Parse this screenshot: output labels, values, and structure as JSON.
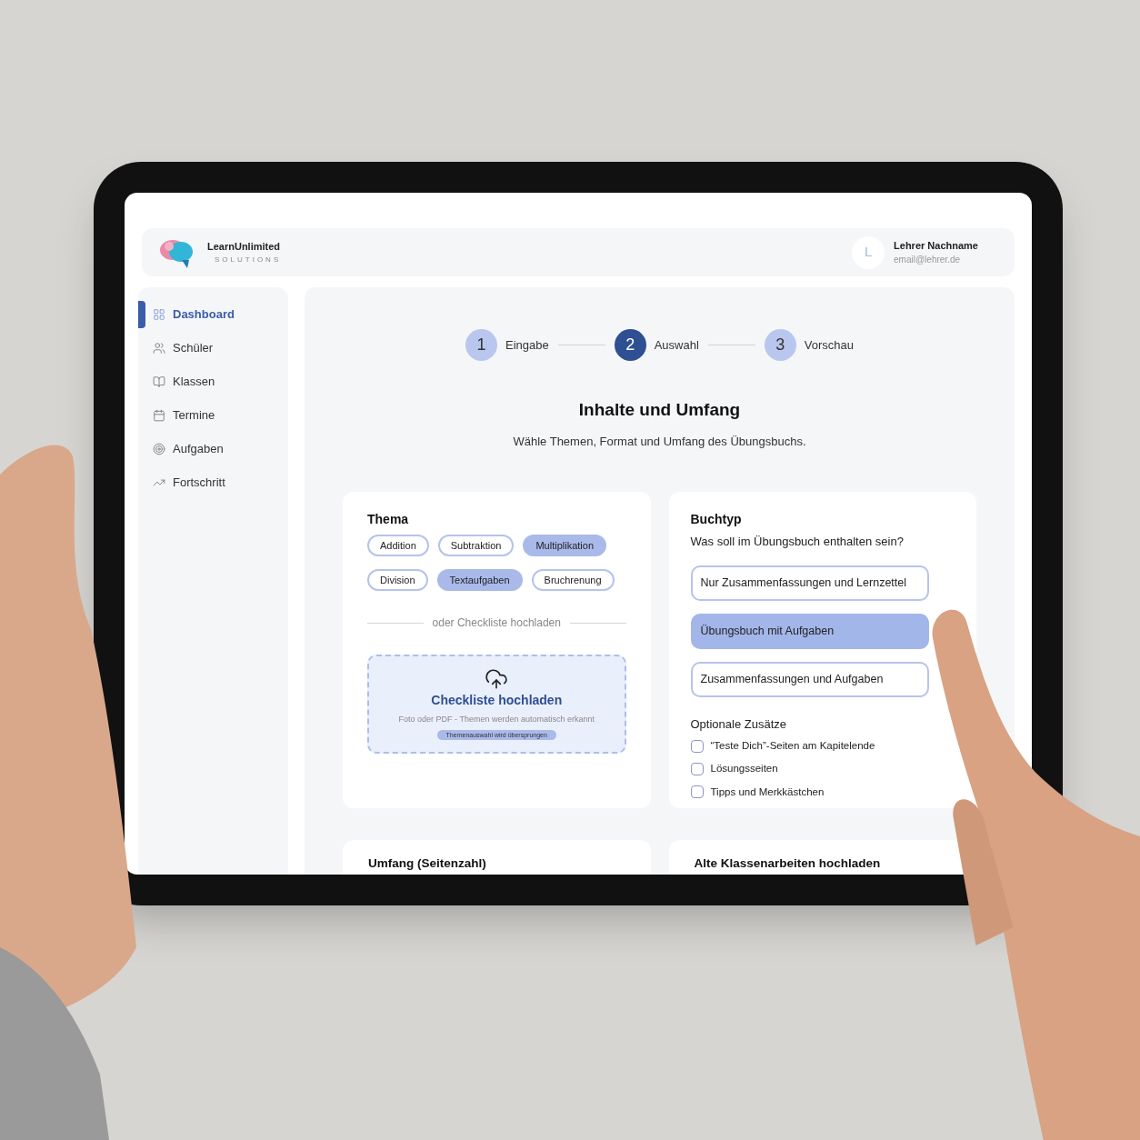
{
  "brand": {
    "name": "LearnUnlimited",
    "tagline": "SOLUTIONS"
  },
  "user": {
    "initial": "L",
    "name": "Lehrer Nachname",
    "email": "email@lehrer.de"
  },
  "sidebar": {
    "items": [
      {
        "label": "Dashboard",
        "selected": true
      },
      {
        "label": "Schüler",
        "selected": false
      },
      {
        "label": "Klassen",
        "selected": false
      },
      {
        "label": "Termine",
        "selected": false
      },
      {
        "label": "Aufgaben",
        "selected": false
      },
      {
        "label": "Fortschritt",
        "selected": false
      }
    ]
  },
  "steps": [
    {
      "number": "1",
      "label": "Eingabe",
      "active": false
    },
    {
      "number": "2",
      "label": "Auswahl",
      "active": true
    },
    {
      "number": "3",
      "label": "Vorschau",
      "active": false
    }
  ],
  "title": "Inhalte und Umfang",
  "subtitle": "Wähle Themen, Format und Umfang des Übungsbuchs.",
  "thema": {
    "title": "Thema",
    "chips": [
      {
        "label": "Addition",
        "selected": false
      },
      {
        "label": "Subtraktion",
        "selected": false
      },
      {
        "label": "Multiplikation",
        "selected": true
      },
      {
        "label": "Division",
        "selected": false
      },
      {
        "label": "Textaufgaben",
        "selected": true
      },
      {
        "label": "Bruchrenung",
        "selected": false
      }
    ],
    "divider": "oder Checkliste hochladen",
    "upload": {
      "title": "Checkliste hochladen",
      "hint": "Foto oder PDF - Themen werden automatisch erkannt",
      "badge": "Themenauswahl wird übersprungen"
    }
  },
  "buchtyp": {
    "title": "Buchtyp",
    "question": "Was soll im Übungsbuch enthalten sein?",
    "options": [
      {
        "label": "Nur Zusammenfassungen und Lernzettel",
        "selected": false
      },
      {
        "label": "Übungsbuch mit Aufgaben",
        "selected": true
      },
      {
        "label": "Zusammenfassungen und Aufgaben",
        "selected": false
      }
    ],
    "extras_title": "Optionale Zusätze",
    "extras": [
      {
        "label": "“Teste Dich”-Seiten am Kapitelende",
        "checked": false
      },
      {
        "label": "Lösungsseiten",
        "checked": false
      },
      {
        "label": "Tipps und Merkkästchen",
        "checked": false
      }
    ]
  },
  "lower_cards": [
    {
      "title": "Umfang (Seitenzahl)"
    },
    {
      "title": "Alte Klassenarbeiten hochladen"
    }
  ]
}
